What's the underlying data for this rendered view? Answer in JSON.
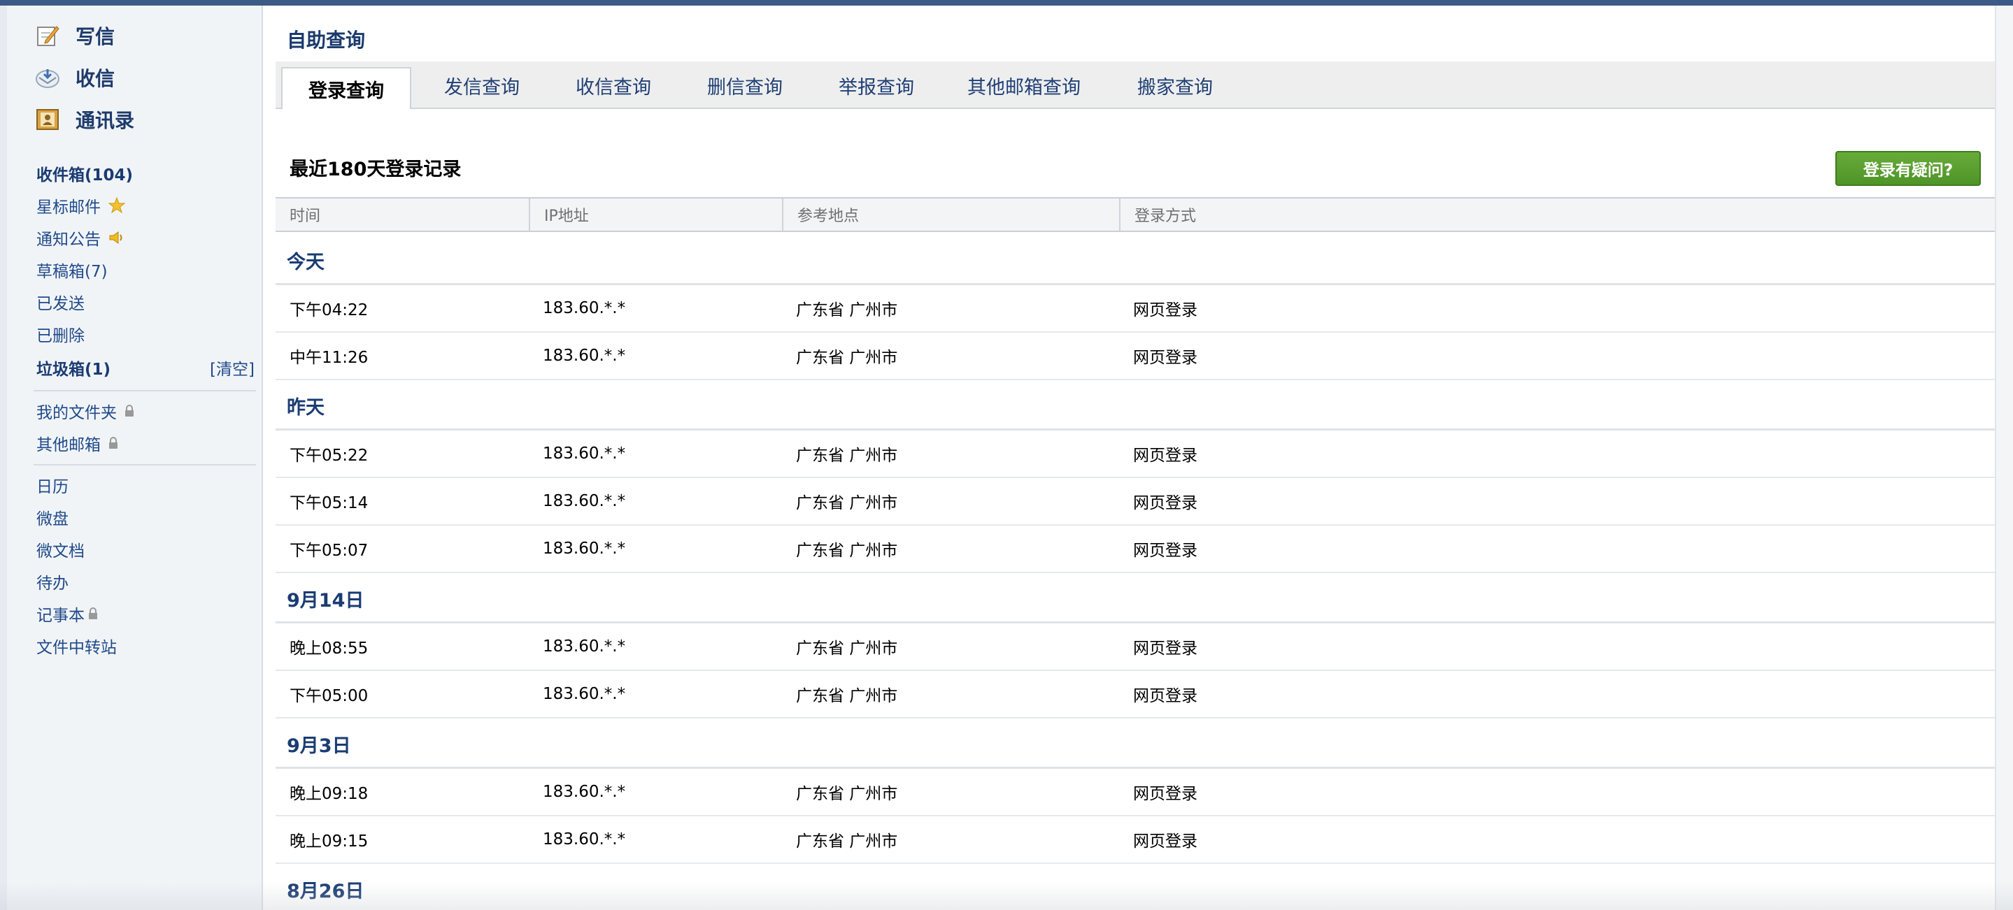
{
  "sidebar": {
    "compose": [
      {
        "label": "写信",
        "icon": "write-icon"
      },
      {
        "label": "收信",
        "icon": "receive-icon"
      },
      {
        "label": "通讯录",
        "icon": "contacts-icon"
      }
    ],
    "folders": [
      {
        "label": "收件箱(104)",
        "bold": true
      },
      {
        "label": "星标邮件",
        "icon": "star-icon"
      },
      {
        "label": "通知公告",
        "icon": "speaker-icon"
      },
      {
        "label": "草稿箱(7)"
      },
      {
        "label": "已发送"
      },
      {
        "label": "已删除"
      },
      {
        "label": "垃圾箱(1)",
        "bold": true
      }
    ],
    "clear_label": "[清空]",
    "private_folders": [
      {
        "label": "我的文件夹",
        "icon": "lock-icon"
      },
      {
        "label": "其他邮箱",
        "icon": "lock-icon"
      }
    ],
    "apps": [
      {
        "label": "日历"
      },
      {
        "label": "微盘"
      },
      {
        "label": "微文档"
      },
      {
        "label": "待办"
      },
      {
        "label": "记事本",
        "icon": "lock-icon"
      },
      {
        "label": "文件中转站"
      }
    ]
  },
  "page": {
    "title": "自助查询",
    "tabs": [
      "登录查询",
      "发信查询",
      "收信查询",
      "删信查询",
      "举报查询",
      "其他邮箱查询",
      "搬家查询"
    ],
    "active_tab": "登录查询",
    "record_title": "最近180天登录记录",
    "help_button": "登录有疑问?"
  },
  "table": {
    "headers": [
      "时间",
      "IP地址",
      "参考地点",
      "登录方式"
    ],
    "groups": [
      {
        "label": "今天",
        "rows": [
          {
            "time": "下午04:22",
            "ip": "183.60.*.*",
            "location": "广东省 广州市",
            "method": "网页登录"
          },
          {
            "time": "中午11:26",
            "ip": "183.60.*.*",
            "location": "广东省 广州市",
            "method": "网页登录"
          }
        ]
      },
      {
        "label": "昨天",
        "rows": [
          {
            "time": "下午05:22",
            "ip": "183.60.*.*",
            "location": "广东省 广州市",
            "method": "网页登录"
          },
          {
            "time": "下午05:14",
            "ip": "183.60.*.*",
            "location": "广东省 广州市",
            "method": "网页登录"
          },
          {
            "time": "下午05:07",
            "ip": "183.60.*.*",
            "location": "广东省 广州市",
            "method": "网页登录"
          }
        ]
      },
      {
        "label": "9月14日",
        "rows": [
          {
            "time": "晚上08:55",
            "ip": "183.60.*.*",
            "location": "广东省 广州市",
            "method": "网页登录"
          },
          {
            "time": "下午05:00",
            "ip": "183.60.*.*",
            "location": "广东省 广州市",
            "method": "网页登录"
          }
        ]
      },
      {
        "label": "9月3日",
        "rows": [
          {
            "time": "晚上09:18",
            "ip": "183.60.*.*",
            "location": "广东省 广州市",
            "method": "网页登录"
          },
          {
            "time": "晚上09:15",
            "ip": "183.60.*.*",
            "location": "广东省 广州市",
            "method": "网页登录"
          }
        ]
      },
      {
        "label": "8月26日",
        "rows": []
      }
    ]
  },
  "colors": {
    "accent": "#1d3a6b",
    "link": "#1f4a8a",
    "button_green": "#5a9e2f",
    "topbar": "#3c5a86"
  }
}
